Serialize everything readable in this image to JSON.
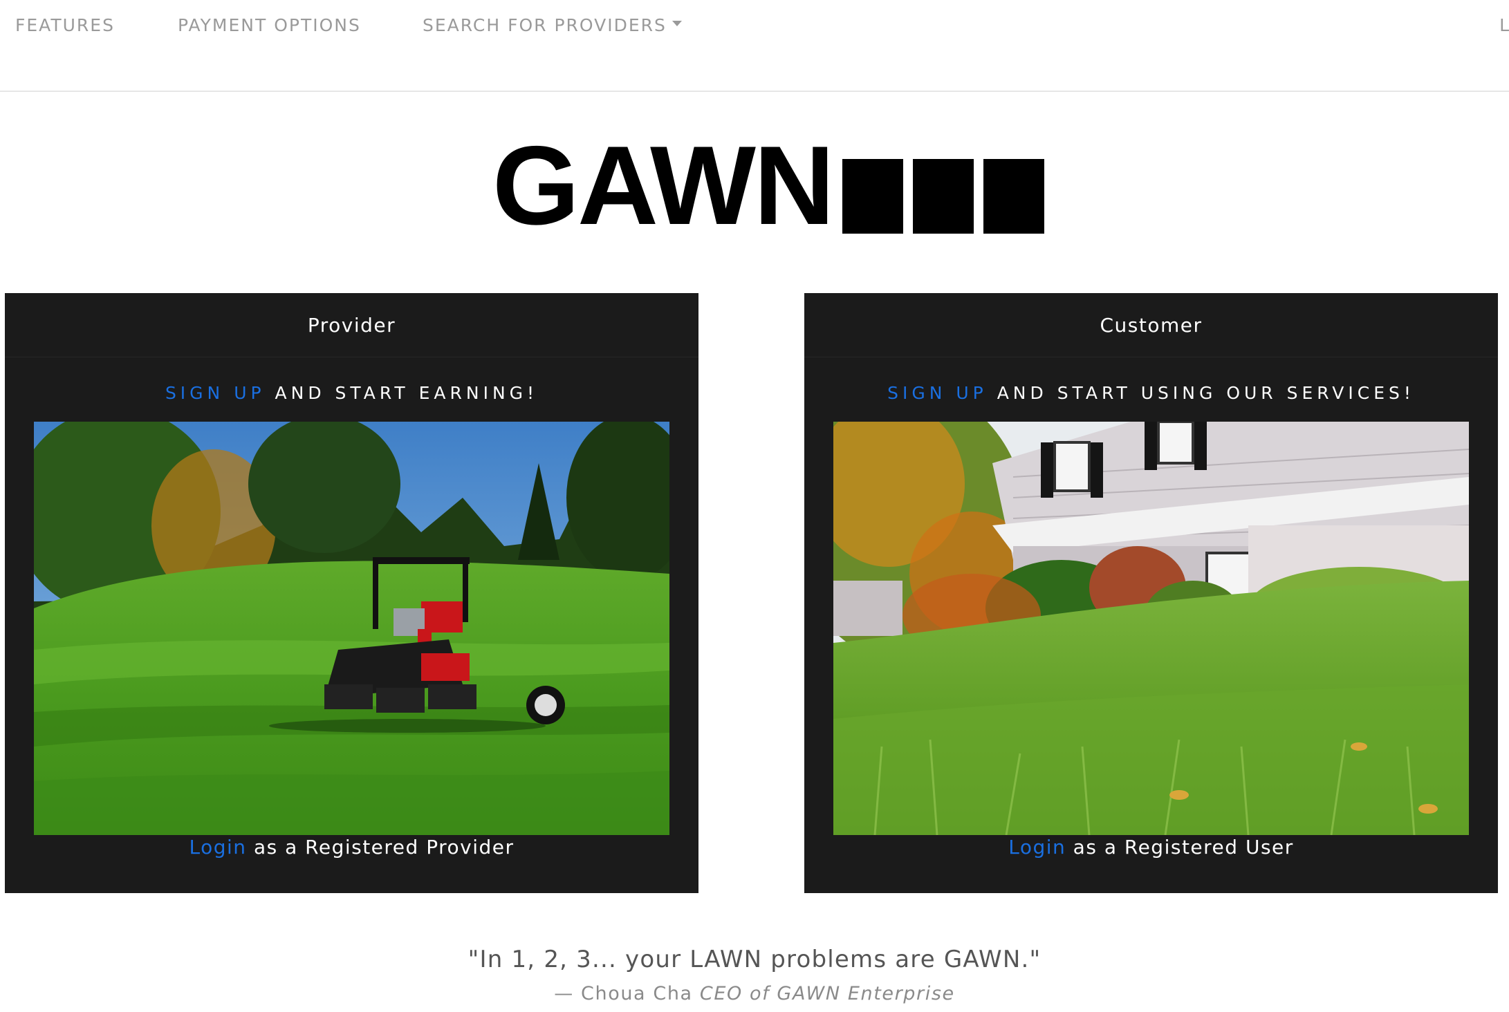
{
  "nav": {
    "items": [
      {
        "label": "FEATURES"
      },
      {
        "label": "PAYMENT OPTIONS"
      },
      {
        "label": "SEARCH FOR PROVIDERS"
      }
    ],
    "edge_label": "L"
  },
  "logo": {
    "text": "GAWN"
  },
  "provider": {
    "title": "Provider",
    "signup_link": "SIGN UP",
    "signup_rest": "AND START EARNING!",
    "login_link": "Login",
    "login_rest": "as a Registered Provider",
    "image": "golf-course-reel-mower"
  },
  "customer": {
    "title": "Customer",
    "signup_link": "SIGN UP",
    "signup_rest": "AND START USING OUR SERVICES!",
    "login_link": "Login",
    "login_rest": "as a Registered User",
    "image": "house-front-lawn"
  },
  "quote": {
    "text": "\"In 1, 2, 3... your LAWN problems are GAWN.\"",
    "author_prefix": "— Choua Cha",
    "author_title": "CEO of GAWN Enterprise"
  },
  "colors": {
    "link_blue": "#1a6fe0",
    "card_bg": "#1b1b1b",
    "nav_text": "#9a9a9a"
  }
}
